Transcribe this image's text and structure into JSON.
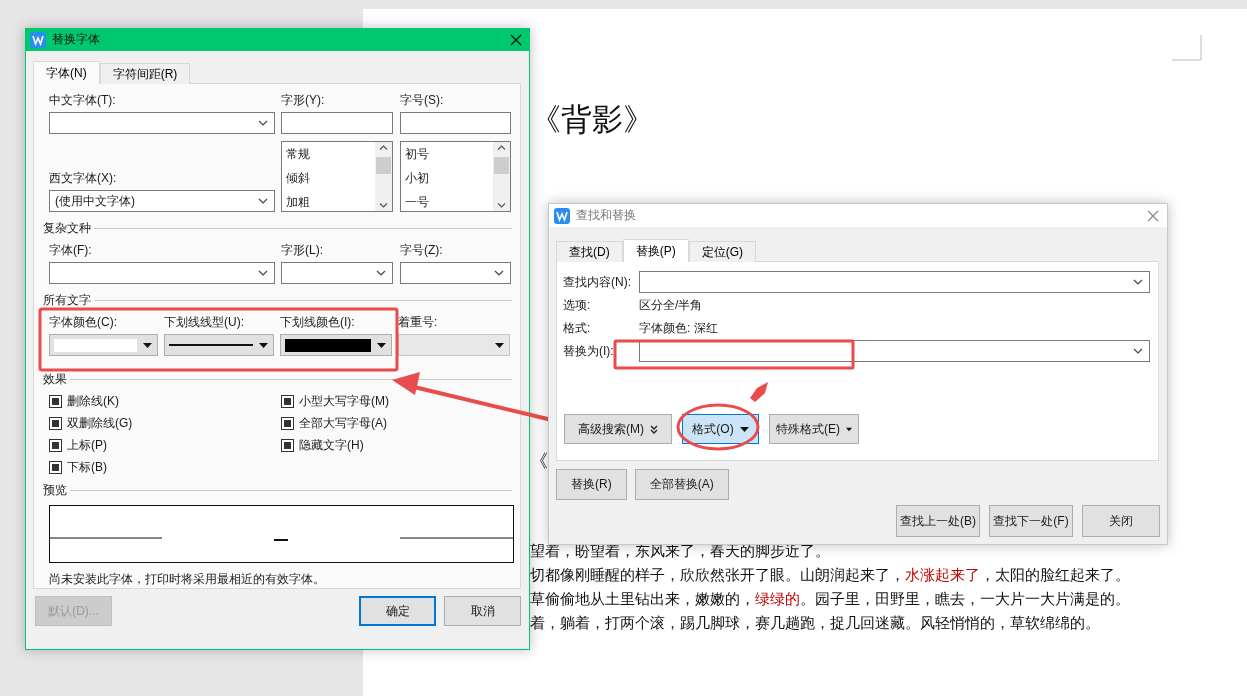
{
  "document": {
    "title": "《背影》",
    "heading_fragment": "《",
    "lines": [
      {
        "segments": [
          {
            "text": "望着，盼望着，东风来了，春天的脚步近了。",
            "highlighted": false
          }
        ]
      },
      {
        "segments": [
          {
            "text": "切都像刚睡醒的样子，欣欣然张开了眼。山朗润起来了，",
            "highlighted": false
          },
          {
            "text": "水涨起来了",
            "highlighted": true
          },
          {
            "text": "，太阳的脸红起来了。",
            "highlighted": false
          }
        ]
      },
      {
        "segments": [
          {
            "text": "草偷偷地从土里钻出来，嫩嫩的，",
            "highlighted": false
          },
          {
            "text": "绿绿的",
            "highlighted": true
          },
          {
            "text": "。园子里，田野里，瞧去，一大片一大片满是的。",
            "highlighted": false
          }
        ]
      },
      {
        "segments": [
          {
            "text": "着，躺着，打两个滚，踢几脚球，赛几趟跑，捉几回迷藏。风轻悄悄的，草软绵绵的。",
            "highlighted": false
          }
        ]
      }
    ]
  },
  "font_dialog": {
    "title": "替换字体",
    "tabs": [
      {
        "label": "字体(N)",
        "selected": true
      },
      {
        "label": "字符间距(R)",
        "selected": false
      }
    ],
    "chinese_font_label": "中文字体(T):",
    "style_label": "字形(Y):",
    "size_label": "字号(S):",
    "style_options": [
      "常规",
      "倾斜",
      "加粗"
    ],
    "size_options": [
      "初号",
      "小初",
      "一号"
    ],
    "western_font_label": "西文字体(X):",
    "western_font_value": "(使用中文字体)",
    "complex": {
      "heading": "复杂文种",
      "font_label": "字体(F):",
      "style_label": "字形(L):",
      "size_label": "字号(Z):"
    },
    "all_text": {
      "heading": "所有文字",
      "pickers": [
        {
          "label": "字体颜色(C):",
          "kind": "color",
          "color": "#ffffff",
          "disabled": false
        },
        {
          "label": "下划线线型(U):",
          "kind": "line",
          "disabled": false
        },
        {
          "label": "下划线颜色(I):",
          "kind": "color",
          "color": "#000000",
          "disabled": false
        },
        {
          "label": "着重号:",
          "kind": "blank",
          "disabled": true
        }
      ]
    },
    "effects": {
      "heading": "效果",
      "items": [
        {
          "label": "删除线(K)",
          "indeterminate": true
        },
        {
          "label": "小型大写字母(M)",
          "indeterminate": true
        },
        {
          "label": "双删除线(G)",
          "indeterminate": true
        },
        {
          "label": "全部大写字母(A)",
          "indeterminate": true
        },
        {
          "label": "上标(P)",
          "indeterminate": true
        },
        {
          "label": "隐藏文字(H)",
          "indeterminate": true
        },
        {
          "label": "下标(B)",
          "indeterminate": true
        }
      ]
    },
    "preview_heading": "预览",
    "note": "尚未安装此字体，打印时将采用最相近的有效字体。",
    "buttons": [
      {
        "label": "默认(D)...",
        "disabled": true,
        "default": false
      },
      {
        "label": "确定",
        "disabled": false,
        "default": true
      },
      {
        "label": "取消",
        "disabled": false,
        "default": false
      }
    ]
  },
  "find_dialog": {
    "title": "查找和替换",
    "tabs": [
      {
        "label": "查找(D)",
        "selected": false
      },
      {
        "label": "替换(P)",
        "selected": true
      },
      {
        "label": "定位(G)",
        "selected": false
      }
    ],
    "find_label": "查找内容(N):",
    "options_label": "选项:",
    "options_value": "区分全/半角",
    "format_label": "格式:",
    "format_value": "字体颜色: 深红",
    "replace_label": "替换为(I):",
    "option_buttons": [
      {
        "label": "高级搜索(M)",
        "kind": "double",
        "selected": false
      },
      {
        "label": "格式(O)",
        "kind": "caret",
        "selected": true
      },
      {
        "label": "特殊格式(E)",
        "kind": "caret",
        "selected": false
      }
    ],
    "replace_buttons": [
      "替换(R)",
      "全部替换(A)"
    ],
    "nav_buttons": [
      "查找上一处(B)",
      "查找下一处(F)",
      "关闭"
    ]
  }
}
